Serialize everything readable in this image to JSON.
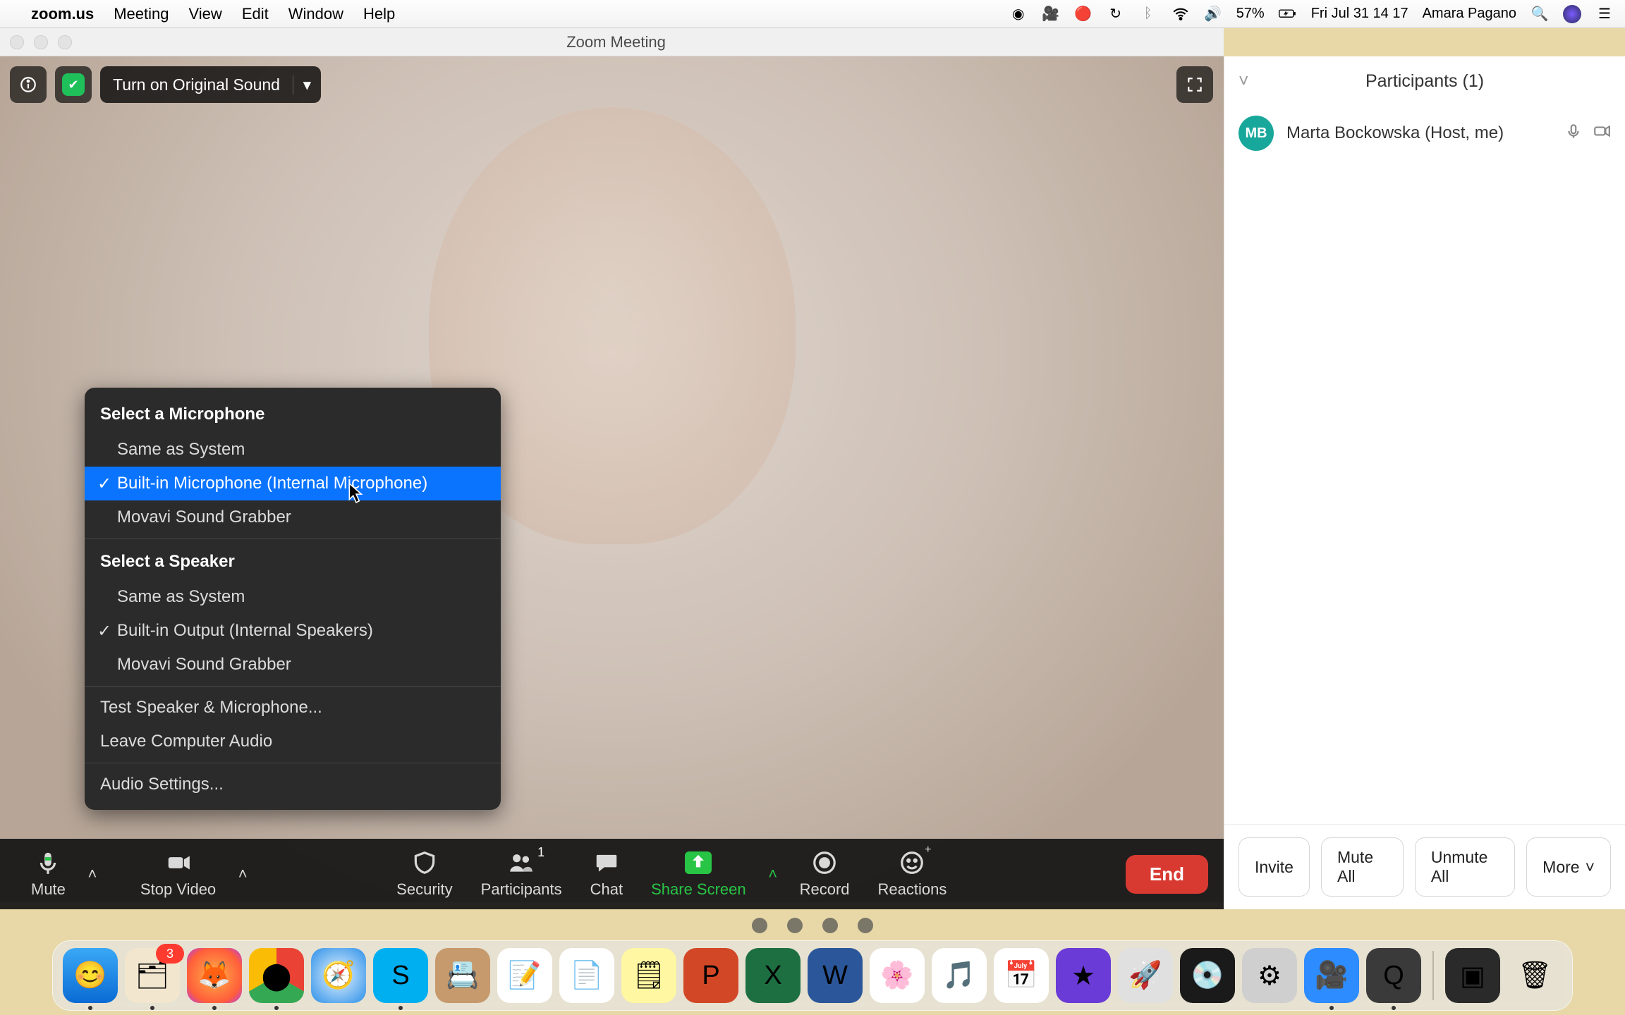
{
  "menubar": {
    "app_name": "zoom.us",
    "items": [
      "Meeting",
      "View",
      "Edit",
      "Window",
      "Help"
    ],
    "battery_text": "57%",
    "clock": "Fri Jul 31  14 17",
    "user_name": "Amara Pagano"
  },
  "window": {
    "title": "Zoom Meeting"
  },
  "top_controls": {
    "original_sound_label": "Turn on Original Sound"
  },
  "audio_menu": {
    "mic_header": "Select a Microphone",
    "mic_options": [
      {
        "label": "Same as System",
        "checked": false,
        "highlight": false
      },
      {
        "label": "Built-in Microphone (Internal Microphone)",
        "checked": true,
        "highlight": true
      },
      {
        "label": "Movavi Sound Grabber",
        "checked": false,
        "highlight": false
      }
    ],
    "spk_header": "Select a Speaker",
    "spk_options": [
      {
        "label": "Same as System",
        "checked": false
      },
      {
        "label": "Built-in Output (Internal Speakers)",
        "checked": true
      },
      {
        "label": "Movavi Sound Grabber",
        "checked": false
      }
    ],
    "test_label": "Test Speaker & Microphone...",
    "leave_label": "Leave Computer Audio",
    "settings_label": "Audio Settings..."
  },
  "toolbar": {
    "mute": "Mute",
    "stop_video": "Stop Video",
    "security": "Security",
    "participants": "Participants",
    "participants_count": "1",
    "chat": "Chat",
    "share_screen": "Share Screen",
    "record": "Record",
    "reactions": "Reactions",
    "end": "End"
  },
  "participants": {
    "header": "Participants (1)",
    "rows": [
      {
        "initials": "MB",
        "name": "Marta Bockowska (Host, me)"
      }
    ],
    "footer": {
      "invite": "Invite",
      "mute_all": "Mute All",
      "unmute_all": "Unmute All",
      "more": "More"
    }
  },
  "dock": {
    "items": [
      {
        "name": "finder",
        "bg": "linear-gradient(#3aa8f6,#0a6bd4)",
        "glyph": "😊",
        "running": true
      },
      {
        "name": "mail-like",
        "bg": "#f2e6cf",
        "glyph": "🗂",
        "running": true,
        "badge": "3"
      },
      {
        "name": "firefox",
        "bg": "radial-gradient(circle,#ffb347,#ff5e3a 70%,#b13af2)",
        "glyph": "🦊",
        "running": true
      },
      {
        "name": "chrome",
        "bg": "conic-gradient(#ea4335 0 120deg,#34a853 120deg 240deg,#fbbc05 240deg 360deg)",
        "glyph": "⬤",
        "running": true
      },
      {
        "name": "safari",
        "bg": "radial-gradient(circle,#e8f4ff,#2a8fe8)",
        "glyph": "🧭",
        "running": false
      },
      {
        "name": "skype",
        "bg": "#00aff0",
        "glyph": "S",
        "running": true
      },
      {
        "name": "contacts",
        "bg": "#c69a6d",
        "glyph": "📇",
        "running": false
      },
      {
        "name": "reminders",
        "bg": "#fff",
        "glyph": "📝",
        "running": false
      },
      {
        "name": "textedit",
        "bg": "#fff",
        "glyph": "📄",
        "running": false
      },
      {
        "name": "notes",
        "bg": "#fff7a1",
        "glyph": "🗒",
        "running": false
      },
      {
        "name": "powerpoint",
        "bg": "#d24726",
        "glyph": "P",
        "running": false
      },
      {
        "name": "excel",
        "bg": "#1d6f42",
        "glyph": "X",
        "running": false
      },
      {
        "name": "word",
        "bg": "#2b579a",
        "glyph": "W",
        "running": false
      },
      {
        "name": "photos",
        "bg": "#fff",
        "glyph": "🌸",
        "running": false
      },
      {
        "name": "music",
        "bg": "#fff",
        "glyph": "🎵",
        "running": false
      },
      {
        "name": "calendar",
        "bg": "#fff",
        "glyph": "📅",
        "running": false
      },
      {
        "name": "imovie",
        "bg": "#6a3bd6",
        "glyph": "★",
        "running": false
      },
      {
        "name": "launchpad-rocket",
        "bg": "#e0e0e0",
        "glyph": "🚀",
        "running": false
      },
      {
        "name": "disc",
        "bg": "#1a1a1a",
        "glyph": "💿",
        "running": false
      },
      {
        "name": "system-preferences",
        "bg": "#cfcfcf",
        "glyph": "⚙",
        "running": false
      },
      {
        "name": "zoom",
        "bg": "#2d8cff",
        "glyph": "🎥",
        "running": true
      },
      {
        "name": "quicktime",
        "bg": "#3a3a3a",
        "glyph": "Q",
        "running": true
      }
    ],
    "right_items": [
      {
        "name": "screen-recording",
        "bg": "#2a2a2a",
        "glyph": "▣"
      },
      {
        "name": "trash",
        "bg": "transparent",
        "glyph": "🗑"
      }
    ]
  }
}
